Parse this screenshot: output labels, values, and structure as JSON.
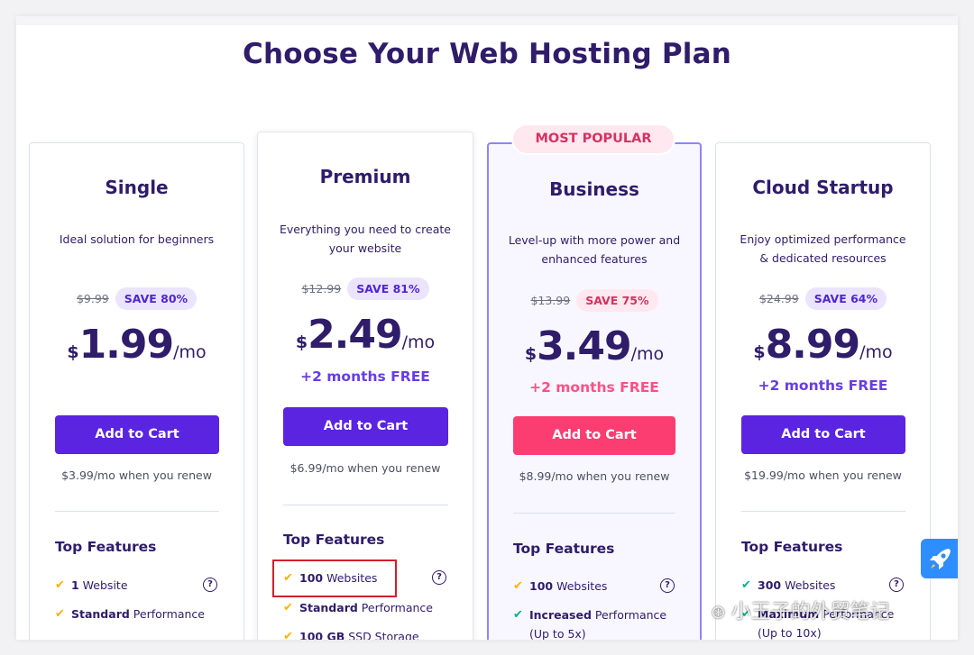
{
  "page_title": "Choose Your Web Hosting Plan",
  "most_popular_badge": "MOST POPULAR",
  "colors": {
    "brand_purple": "#5a24e0",
    "popular_pink": "#fc3d72",
    "navy_text": "#2f1c6a",
    "free_purple": "#673de6",
    "check_yellow": "#ffb000",
    "check_green": "#00b090"
  },
  "plans": [
    {
      "name": "Single",
      "description": "Ideal solution for beginners",
      "old_price": "$9.99",
      "save": "SAVE 80%",
      "currency": "$",
      "price": "1.99",
      "per": "/mo",
      "free": "",
      "cta": "Add to Cart",
      "renew": "$3.99/mo when you renew",
      "features_title": "Top Features",
      "features": [
        {
          "bold": "1",
          "rest": " Website",
          "help": "?"
        },
        {
          "bold": "Standard",
          "rest": " Performance",
          "help": ""
        }
      ]
    },
    {
      "name": "Premium",
      "description": "Everything you need to create your website",
      "old_price": "$12.99",
      "save": "SAVE 81%",
      "currency": "$",
      "price": "2.49",
      "per": "/mo",
      "free": "+2 months FREE",
      "cta": "Add to Cart",
      "renew": "$6.99/mo when you renew",
      "features_title": "Top Features",
      "features": [
        {
          "bold": "100",
          "rest": " Websites",
          "help": "?"
        },
        {
          "bold": "Standard",
          "rest": " Performance",
          "help": ""
        },
        {
          "bold": "100 GB",
          "rest": " SSD Storage",
          "help": ""
        }
      ]
    },
    {
      "name": "Business",
      "description": "Level-up with more power and enhanced features",
      "old_price": "$13.99",
      "save": "SAVE 75%",
      "currency": "$",
      "price": "3.49",
      "per": "/mo",
      "free": "+2 months FREE",
      "cta": "Add to Cart",
      "renew": "$8.99/mo when you renew",
      "features_title": "Top Features",
      "features": [
        {
          "bold": "100",
          "rest": " Websites",
          "help": "?"
        },
        {
          "bold": "Increased",
          "rest": " Performance (Up to 5x)",
          "help": ""
        }
      ]
    },
    {
      "name": "Cloud Startup",
      "description": "Enjoy optimized performance & dedicated resources",
      "old_price": "$24.99",
      "save": "SAVE 64%",
      "currency": "$",
      "price": "8.99",
      "per": "/mo",
      "free": "+2 months FREE",
      "cta": "Add to Cart",
      "renew": "$19.99/mo when you renew",
      "features_title": "Top Features",
      "features": [
        {
          "bold": "300",
          "rest": " Websites",
          "help": "?"
        },
        {
          "bold": "Maximum",
          "rest": " Performance (Up to 10x)",
          "help": ""
        }
      ]
    }
  ],
  "check_glyph": "✔",
  "watermark": "小王子的外贸笔记"
}
